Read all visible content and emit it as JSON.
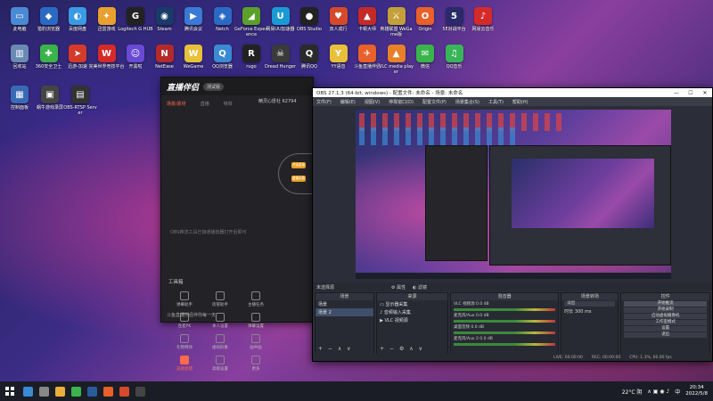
{
  "desktop": {
    "row1": [
      {
        "label": "此电脑",
        "color": "#4a8ad4",
        "glyph": "▭"
      },
      {
        "label": "猎豹浏览器",
        "color": "#2a6ac4",
        "glyph": "◆"
      },
      {
        "label": "百度网盘",
        "color": "#3a9ae4",
        "glyph": "◐"
      },
      {
        "label": "迅雷游戏",
        "color": "#e8a030",
        "glyph": "✦"
      },
      {
        "label": "Logitech G HUB",
        "color": "#222",
        "glyph": "G"
      },
      {
        "label": "Steam",
        "color": "#1a3a6a",
        "glyph": "◉"
      },
      {
        "label": "腾讯会议",
        "color": "#3a7ad4",
        "glyph": "▶"
      },
      {
        "label": "Netch",
        "color": "#2a6ac4",
        "glyph": "◈"
      },
      {
        "label": "GeForce Experience",
        "color": "#5aa02a",
        "glyph": "◢"
      },
      {
        "label": "网易UU加速器",
        "color": "#1a9ad4",
        "glyph": "U"
      },
      {
        "label": "OBS Studio",
        "color": "#222",
        "glyph": "●"
      },
      {
        "label": "双人成行",
        "color": "#d44a2a",
        "glyph": "♥"
      },
      {
        "label": "卡顿大师",
        "color": "#c42a2a",
        "glyph": "▲"
      },
      {
        "label": "英雄联盟 WeGame版",
        "color": "#c4a03a",
        "glyph": "⚔"
      },
      {
        "label": "Origin",
        "color": "#e8602a",
        "glyph": "O"
      },
      {
        "label": "5E对战平台",
        "color": "#2a2a6a",
        "glyph": "5"
      },
      {
        "label": "网易云音乐",
        "color": "#d42a2a",
        "glyph": "♪"
      }
    ],
    "row2": [
      {
        "label": "回收站",
        "color": "#6a8ab4",
        "glyph": "▥"
      },
      {
        "label": "360安全卫士",
        "color": "#3ab44a",
        "glyph": "✚"
      },
      {
        "label": "迅游-加速",
        "color": "#d43a2a",
        "glyph": "➤"
      },
      {
        "label": "完美世界竞技平台",
        "color": "#d42a2a",
        "glyph": "W"
      },
      {
        "label": "开黑啦",
        "color": "#6a4ad4",
        "glyph": "☺"
      },
      {
        "label": "NetEase",
        "color": "#b42a2a",
        "glyph": "N"
      },
      {
        "label": "WeGame",
        "color": "#e8c03a",
        "glyph": "W"
      },
      {
        "label": "QQ浏览器",
        "color": "#3a8ad4",
        "glyph": "Q"
      },
      {
        "label": "rugo",
        "color": "#222",
        "glyph": "R"
      },
      {
        "label": "Dread Hunger",
        "color": "#3a3a3a",
        "glyph": "☠"
      },
      {
        "label": "腾讯QQ",
        "color": "#2a2a2a",
        "glyph": "Q"
      },
      {
        "label": "YY语音",
        "color": "#e8c03a",
        "glyph": "Y"
      },
      {
        "label": "斗鱼直播伴侣",
        "color": "#e8602a",
        "glyph": "✈"
      },
      {
        "label": "VLC media player",
        "color": "#e8802a",
        "glyph": "▲"
      },
      {
        "label": "微信",
        "color": "#3ab44a",
        "glyph": "✉"
      },
      {
        "label": "QQ音乐",
        "color": "#3ab45a",
        "glyph": "♫"
      }
    ],
    "row3": [
      {
        "label": "控制面板",
        "color": "#3a6ab4",
        "glyph": "▦"
      },
      {
        "label": "蜗牛游戏录屏",
        "color": "#444",
        "glyph": "▣"
      },
      {
        "label": "OBS-RTSP Server",
        "color": "#333",
        "glyph": "▤"
      }
    ]
  },
  "live_app": {
    "logo": "直播伴侣",
    "version": "测试版",
    "tabs": [
      "场景/素材",
      "直播",
      "特效"
    ],
    "empty_hint": "OBS推流工具已接通播放器打开后即可",
    "toolbox_title": "工具箱",
    "tools": [
      "弹幕助手",
      "房管助手",
      "主播任务",
      "连麦PK",
      "本人设置",
      "弹幕设置",
      "礼物特效",
      "虚拟形象",
      "画中画",
      "美颜滤镜",
      "高级设置",
      "更多"
    ],
    "bottom_text": "斗鱼直播伴侣伴你每一天",
    "fans_label": "精灵心愿社 62794",
    "live_buttons": [
      "开始直播",
      "直播设置"
    ]
  },
  "obs": {
    "title": "OBS 27.1.3 (64-bit, windows) - 配置文件: 未命名 - 场景: 未命名",
    "menu": [
      "文件(F)",
      "编辑(E)",
      "视图(V)",
      "停靠窗口(D)",
      "配置文件(P)",
      "场景集合(S)",
      "工具(T)",
      "帮助(H)"
    ],
    "status_left": "未选择源",
    "status_props": "属性",
    "status_filters": "滤镜",
    "docks": {
      "scenes": {
        "title": "场景",
        "items": [
          "场景",
          "场景 2"
        ],
        "selected": 1
      },
      "sources": {
        "title": "来源",
        "items": [
          "显示器采集",
          "音频输入采集",
          "VLC 视频源"
        ]
      },
      "mixer": {
        "title": "混音器",
        "rows": [
          {
            "name": "VLC 视频源",
            "db": "0.0 dB"
          },
          {
            "name": "麦克风/Aux",
            "db": "0.0 dB"
          },
          {
            "name": "桌面音频",
            "db": "0.0 dB"
          },
          {
            "name": "麦克风/Aux 2",
            "db": "0.0 dB"
          }
        ]
      },
      "transitions": {
        "title": "场景转场",
        "type": "淡出",
        "duration_label": "时长",
        "duration": "300 ms"
      },
      "controls": {
        "title": "控件",
        "buttons": [
          "开始推流",
          "开始录制",
          "启动虚拟摄像机",
          "工作室模式",
          "设置",
          "退出"
        ]
      }
    },
    "status_bar": [
      "LIVE: 00:00:00",
      "REC: 00:00:00",
      "CPU: 1.3%, 60.00 fps"
    ]
  },
  "taskbar": {
    "weather": "22°C 阴",
    "time": "20:34",
    "date": "2022/5/8",
    "lang": "中",
    "apps": [
      {
        "name": "search",
        "color": "#3a8ad4"
      },
      {
        "name": "task-view",
        "color": "#888"
      },
      {
        "name": "explorer",
        "color": "#e8b03a"
      },
      {
        "name": "wechat",
        "color": "#3ab44a"
      },
      {
        "name": "steam",
        "color": "#2a5a9a"
      },
      {
        "name": "douyu",
        "color": "#e8602a"
      },
      {
        "name": "live",
        "color": "#d44a2a"
      },
      {
        "name": "obs",
        "color": "#444"
      }
    ]
  }
}
